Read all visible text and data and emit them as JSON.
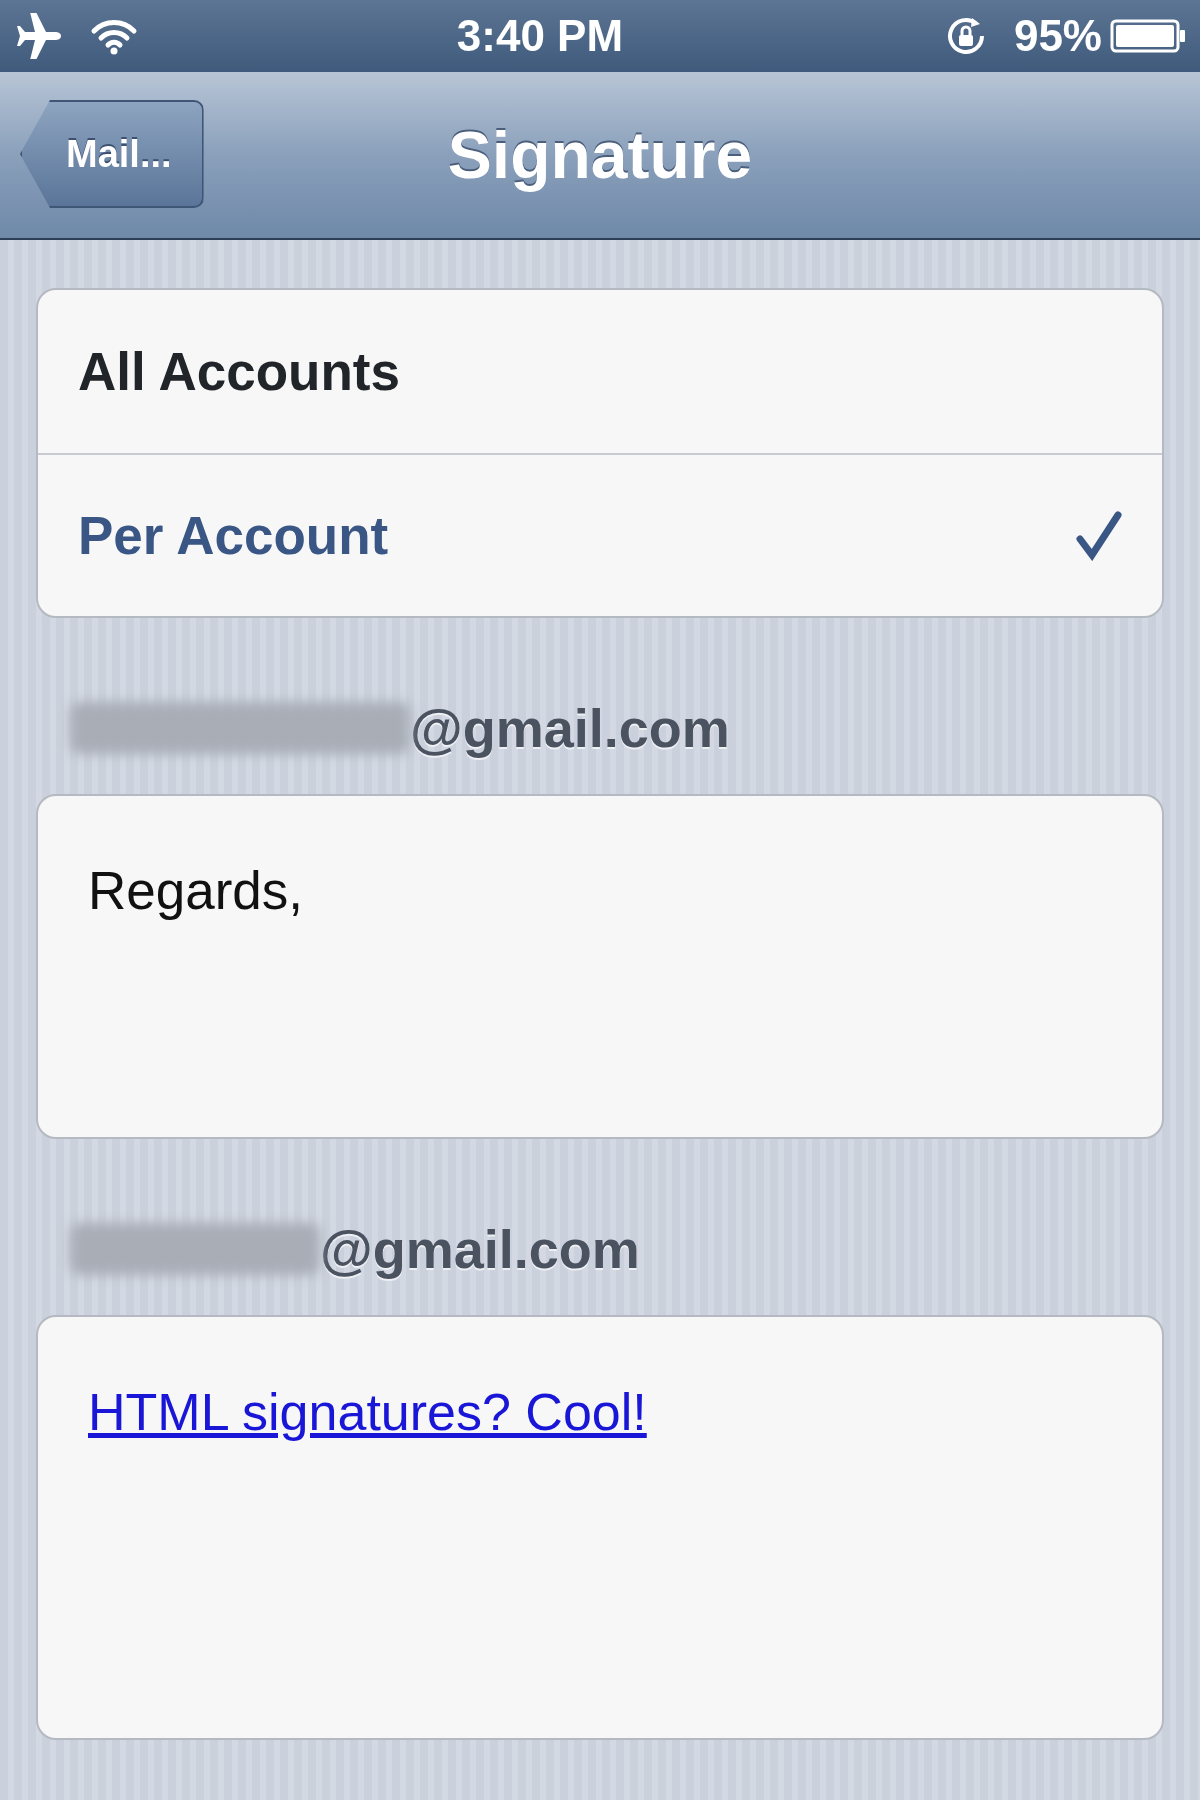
{
  "status_bar": {
    "time": "3:40 PM",
    "battery": "95%"
  },
  "nav_bar": {
    "back_button": "Mail...",
    "title": "Signature"
  },
  "options": [
    {
      "label": "All Accounts",
      "selected": false
    },
    {
      "label": "Per Account",
      "selected": true
    }
  ],
  "accounts": [
    {
      "email": "@gmail.com",
      "signature": "Regards,",
      "kind": "plain"
    },
    {
      "email": "@gmail.com",
      "signature": "HTML signatures? Cool!",
      "kind": "link"
    }
  ]
}
